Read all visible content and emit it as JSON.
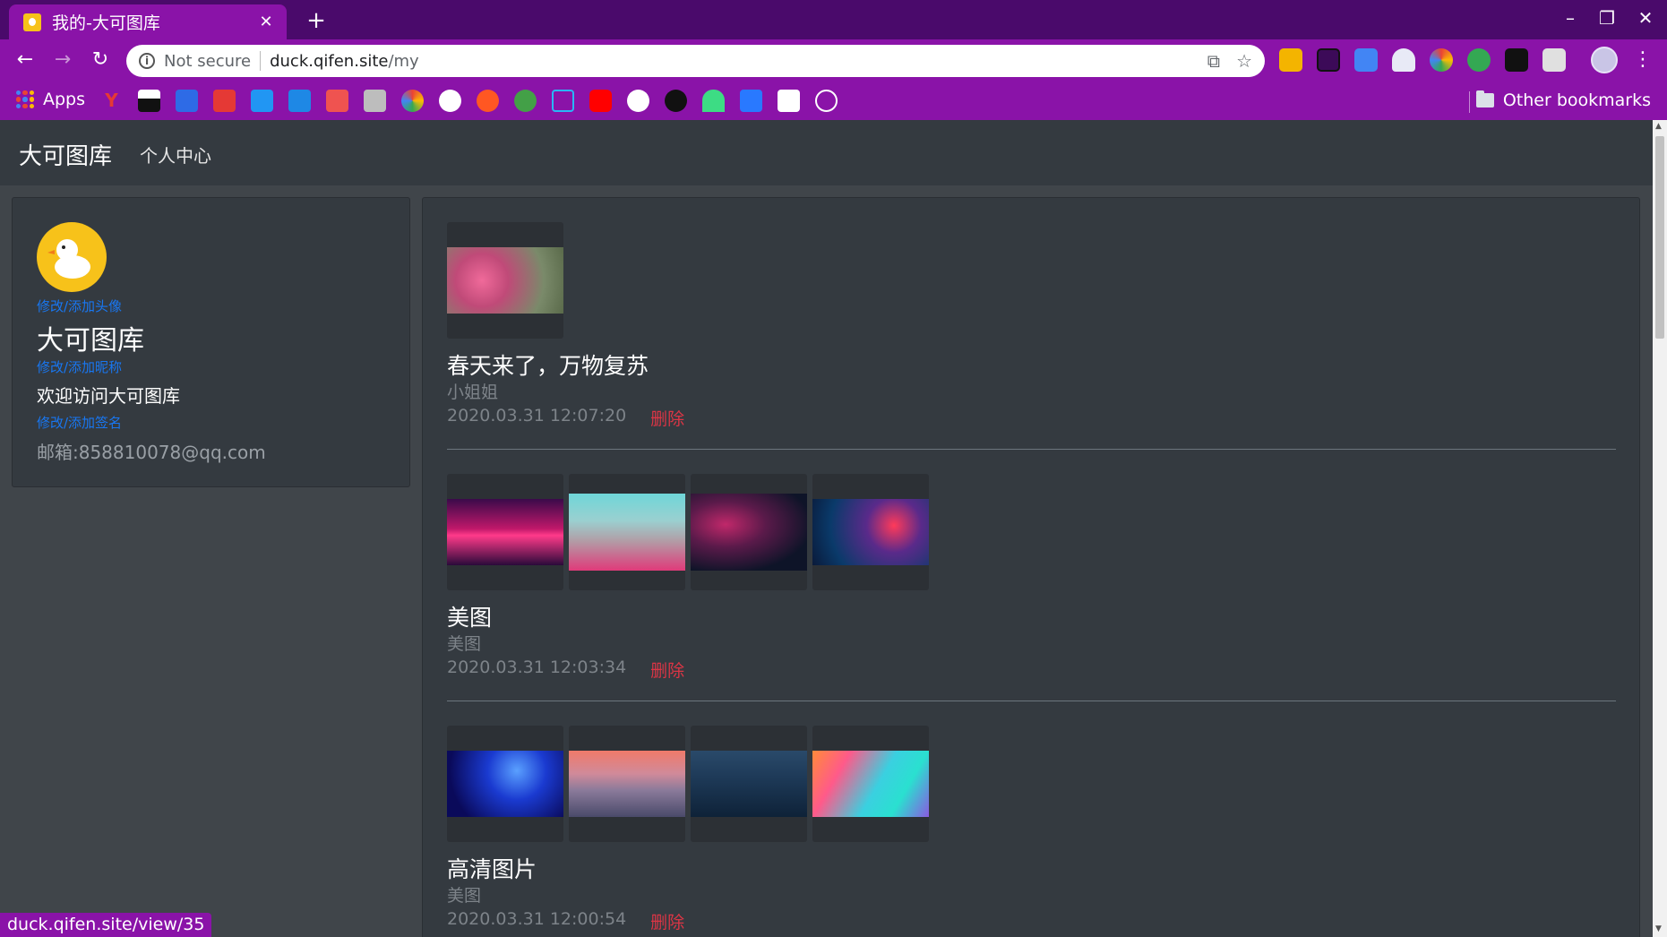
{
  "browser": {
    "tab_title": "我的-大可图库",
    "tab_close": "✕",
    "new_tab": "+",
    "omnibox": {
      "security": "Not secure",
      "domain": "duck.qifen.site",
      "path": "/my"
    },
    "apps_label": "Apps",
    "other_bookmarks": "Other bookmarks",
    "status_url": "duck.qifen.site/view/35",
    "colors": {
      "frame": "#4a0a6b",
      "toolbar": "#8a13a8"
    }
  },
  "navbar": {
    "brand": "大可图库",
    "link": "个人中心"
  },
  "profile": {
    "edit_avatar": "修改/添加头像",
    "name": "大可图库",
    "edit_name": "修改/添加昵称",
    "signature": "欢迎访问大可图库",
    "edit_signature": "修改/添加签名",
    "email": "邮箱:858810078@qq.com"
  },
  "posts": [
    {
      "title": "春天来了，万物复苏",
      "tag": "小姐姐",
      "time": "2020.03.31 12:07:20",
      "delete": "删除",
      "images": [
        "pink-flowers"
      ]
    },
    {
      "title": "美图",
      "tag": "美图",
      "time": "2020.03.31 12:03:34",
      "delete": "删除",
      "images": [
        "neon-city-sunset",
        "pink-cityscape",
        "starry-nebula",
        "neon-maple-leaves"
      ]
    },
    {
      "title": "高清图片",
      "tag": "美图",
      "time": "2020.03.31 12:00:54",
      "delete": "删除",
      "images": [
        "blue-lighthouse",
        "pink-sunset-mountains",
        "blue-mountain-valley",
        "colorful-wave"
      ]
    }
  ]
}
